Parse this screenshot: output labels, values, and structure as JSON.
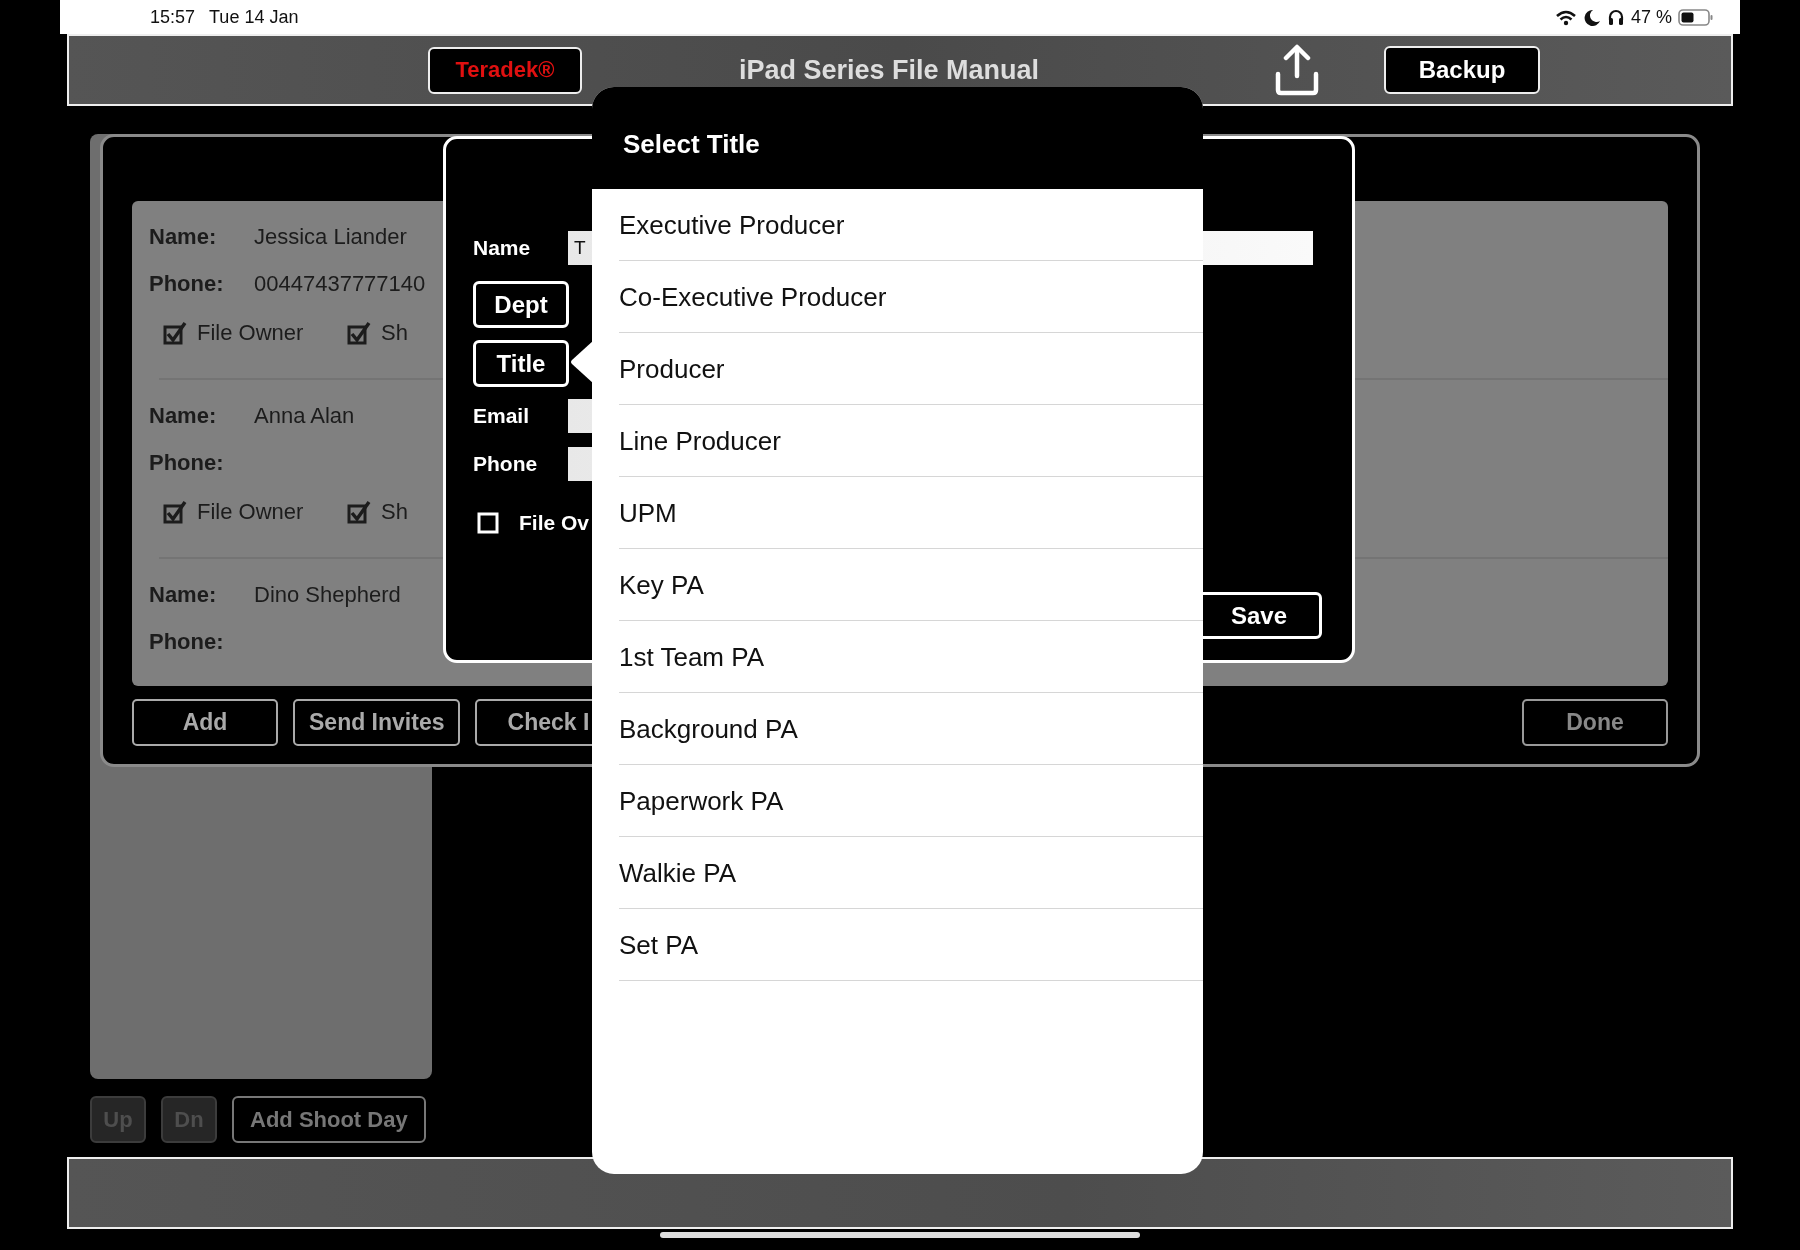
{
  "status_bar": {
    "time": "15:57",
    "date": "Tue 14 Jan",
    "battery_percent": "47 %"
  },
  "header": {
    "brand_button": "Teradek®",
    "title": "iPad Series File Manual",
    "backup_button": "Backup"
  },
  "shoot_day_buttons": [
    {
      "label": "Up",
      "disabled": true
    },
    {
      "label": "Dn",
      "disabled": true
    },
    {
      "label": "Add Shoot Day",
      "disabled": false
    }
  ],
  "contacts": [
    {
      "name_label": "Name:",
      "name": "Jessica Liander",
      "phone_label": "Phone:",
      "phone": "00447437777140",
      "checks": [
        {
          "label": "File Owner",
          "checked": true
        },
        {
          "label": "Sh",
          "checked": true
        }
      ]
    },
    {
      "name_label": "Name:",
      "name": "Anna Alan",
      "phone_label": "Phone:",
      "checks": [
        {
          "label": "File Owner",
          "checked": true
        },
        {
          "label": "Sh",
          "checked": true
        }
      ]
    },
    {
      "name_label": "Name:",
      "name": "Dino Shepherd",
      "phone_label": "Phone:"
    }
  ],
  "contact_buttons": [
    "Add",
    "Send Invites",
    "Check I"
  ],
  "done_button": "Done",
  "edit_dialog": {
    "name_label": "Name",
    "name_value": "T",
    "dept_button": "Dept",
    "title_button": "Title",
    "email_label": "Email",
    "phone_label": "Phone",
    "file_owner": {
      "label": "File Ov",
      "checked": false
    },
    "save_button": "Save"
  },
  "title_picker": {
    "title": "Select Title",
    "items": [
      "Executive Producer",
      "Co-Executive Producer",
      "Producer",
      "Line Producer",
      "UPM",
      "Key PA",
      "1st Team PA",
      "Background PA",
      "Paperwork PA",
      "Walkie PA",
      "Set PA"
    ]
  }
}
